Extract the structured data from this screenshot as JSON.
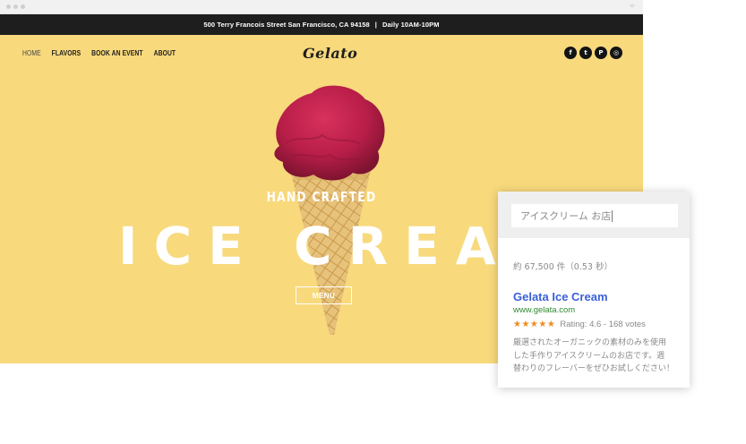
{
  "website": {
    "topbar": {
      "address": "500 Terry Francois Street San Francisco, CA 94158",
      "separator": "|",
      "hours": "Daily 10AM-10PM"
    },
    "nav": {
      "items": [
        {
          "label": "HOME",
          "active": true
        },
        {
          "label": "FLAVORS"
        },
        {
          "label": "BOOK AN EVENT"
        },
        {
          "label": "ABOUT"
        }
      ]
    },
    "logo": "Gelato",
    "social": [
      {
        "icon": "facebook-icon",
        "glyph": "f"
      },
      {
        "icon": "twitter-icon",
        "glyph": "t"
      },
      {
        "icon": "pinterest-icon",
        "glyph": "P"
      },
      {
        "icon": "instagram-icon",
        "glyph": "◎"
      }
    ],
    "hero": {
      "eyebrow": "HAND CRAFTED",
      "headline": "ICE CREAM",
      "button": "MENU",
      "background": "#f8d97c"
    }
  },
  "search_card": {
    "query": "アイスクリーム お店",
    "result_count": "約 67,500 件（0.53 秒）",
    "result": {
      "title": "Gelata Ice Cream",
      "url": "www.gelata.com",
      "stars": "★★★★★",
      "rating_text": "Rating: 4.6 - 168 votes",
      "rating": 4.6,
      "description_lines": [
        "厳選されたオーガニックの素材のみを使用",
        "した手作りアイスクリームのお店です。週",
        "替わりのフレーバーをぜひお試しください！"
      ]
    },
    "colors": {
      "title": "#3b60d6",
      "url": "#2f8a30",
      "stars": "#ef8c1d"
    }
  }
}
